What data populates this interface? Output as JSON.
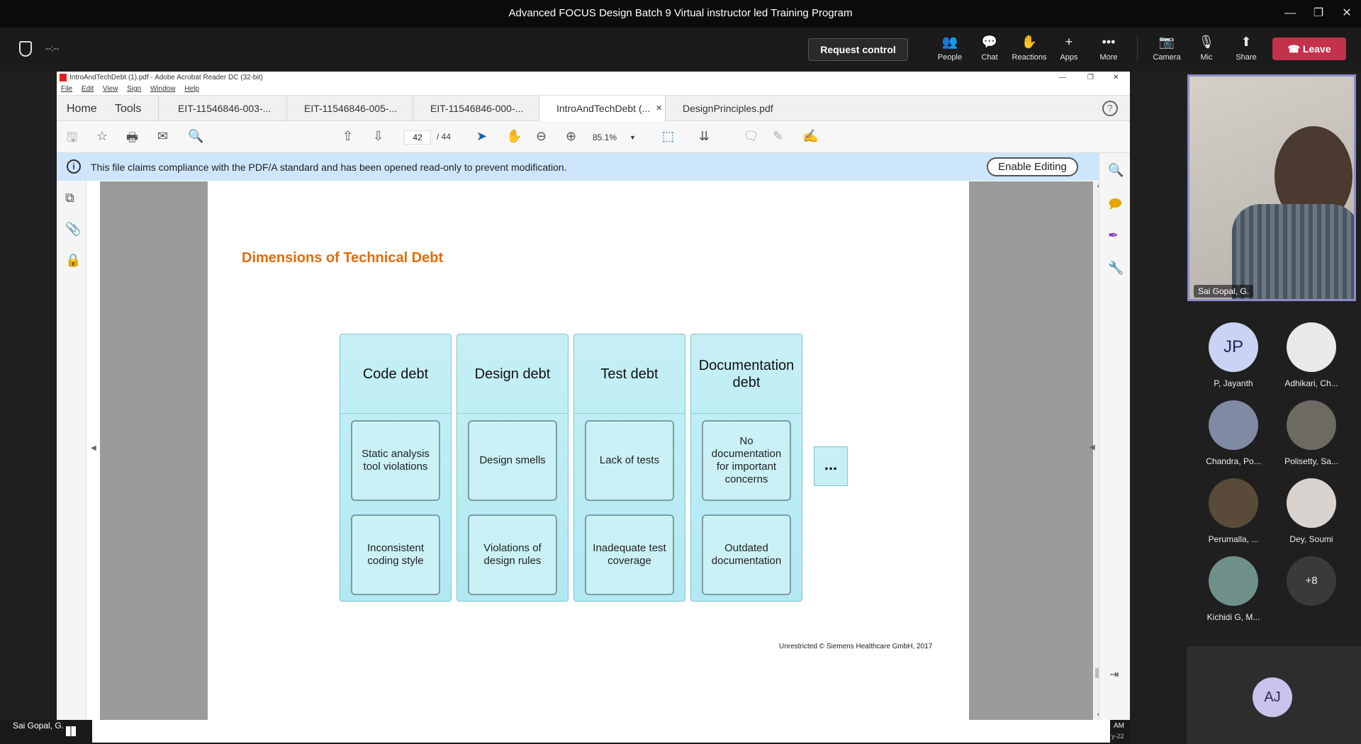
{
  "window": {
    "title": "Advanced FOCUS Design Batch 9 Virtual instructor led Training Program",
    "timer": "--:--"
  },
  "callbar": {
    "request_control": "Request control",
    "tools": [
      {
        "label": "People",
        "icon": "people-icon"
      },
      {
        "label": "Chat",
        "icon": "chat-icon"
      },
      {
        "label": "Reactions",
        "icon": "reactions-icon"
      },
      {
        "label": "Apps",
        "icon": "apps-icon"
      },
      {
        "label": "More",
        "icon": "more-icon"
      },
      {
        "label": "Camera",
        "icon": "camera-icon"
      },
      {
        "label": "Mic",
        "icon": "mic-icon"
      },
      {
        "label": "Share",
        "icon": "share-icon"
      }
    ],
    "leave": "Leave",
    "leave_color": "#c4314b"
  },
  "acrobat": {
    "title": "IntroAndTechDebt (1).pdf - Adobe Acrobat Reader DC (32-bit)",
    "menu": [
      "File",
      "Edit",
      "View",
      "Sign",
      "Window",
      "Help"
    ],
    "nav_tabs": [
      "Home",
      "Tools"
    ],
    "doc_tabs": [
      "EIT-11546846-003-...",
      "EIT-11546846-005-...",
      "EIT-11546846-000-...",
      "IntroAndTechDebt (...",
      "DesignPrinciples.pdf"
    ],
    "page_current": "42",
    "page_total": "/ 44",
    "zoom": "85.1%",
    "info_message": "This file claims compliance with the PDF/A standard and has been opened read-only to prevent modification.",
    "enable_editing": "Enable Editing"
  },
  "slide": {
    "title": "Dimensions of Technical Debt",
    "title_color": "#e46c0a",
    "columns": [
      {
        "head": "Code debt",
        "cells": [
          "Static analysis tool violations",
          "Inconsistent coding style"
        ]
      },
      {
        "head": "Design debt",
        "cells": [
          "Design smells",
          "Violations of design rules"
        ]
      },
      {
        "head": "Test debt",
        "cells": [
          "Lack of tests",
          "Inadequate test coverage"
        ]
      },
      {
        "head": "Documentation debt",
        "cells": [
          "No documentation for important concerns",
          "Outdated documentation"
        ]
      }
    ],
    "more": "...",
    "footer": "Unrestricted © Siemens Healthcare GmbH, 2017"
  },
  "participants": {
    "presenter": "Sai Gopal, G.",
    "list": [
      {
        "name": "P, Jayanth",
        "initials": "JP",
        "color": "#c9d3f3"
      },
      {
        "name": "Adhikari, Ch...",
        "initials": "",
        "color": "#e9e9e9"
      },
      {
        "name": "Chandra, Po...",
        "initials": "",
        "color": "#7f8aa3"
      },
      {
        "name": "Polisetty, Sa...",
        "initials": "",
        "color": "#6d6a62"
      },
      {
        "name": "Perumalla, ...",
        "initials": "",
        "color": "#5a4a3a"
      },
      {
        "name": "Dey, Soumi",
        "initials": "",
        "color": "#d9d3cf"
      },
      {
        "name": "Kichidi G, M...",
        "initials": "",
        "color": "#6f8f8a"
      },
      {
        "name": "",
        "initials": "+8",
        "color": "#3a3a3a"
      }
    ],
    "extra": {
      "initials": "AJ",
      "color": "#c9c3ec"
    }
  },
  "taskbar": {
    "name": "Sai Gopal, G.",
    "clock_top": "AM",
    "clock_bottom": "y-22"
  }
}
